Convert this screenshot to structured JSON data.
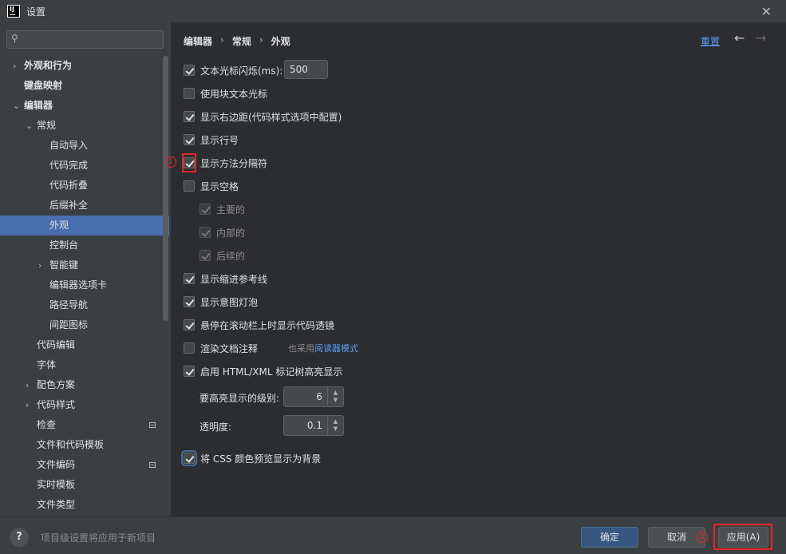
{
  "window": {
    "title": "设置",
    "logo_text": "IJ"
  },
  "search": {
    "placeholder": ""
  },
  "sidebar": {
    "items": [
      {
        "label": "外观和行为",
        "arrow": "›",
        "bold": true
      },
      {
        "label": "键盘映射",
        "bold": true
      },
      {
        "label": "编辑器",
        "arrow": "⌄",
        "bold": true
      },
      {
        "label": "常规",
        "arrow": "⌄"
      },
      {
        "label": "自动导入"
      },
      {
        "label": "代码完成"
      },
      {
        "label": "代码折叠"
      },
      {
        "label": "后缀补全"
      },
      {
        "label": "外观"
      },
      {
        "label": "控制台"
      },
      {
        "label": "智能键",
        "arrow": "›"
      },
      {
        "label": "编辑器选项卡"
      },
      {
        "label": "路径导航"
      },
      {
        "label": "间距图标"
      },
      {
        "label": "代码编辑"
      },
      {
        "label": "字体"
      },
      {
        "label": "配色方案",
        "arrow": "›"
      },
      {
        "label": "代码样式",
        "arrow": "›"
      },
      {
        "label": "检查"
      },
      {
        "label": "文件和代码模板"
      },
      {
        "label": "文件编码"
      },
      {
        "label": "实时模板"
      },
      {
        "label": "文件类型"
      }
    ],
    "selected": "外观"
  },
  "breadcrumb": {
    "items": [
      "编辑器",
      "常规",
      "外观"
    ],
    "separator": "›"
  },
  "header": {
    "reset_label": "重置",
    "back_icon": "←",
    "forward_icon": "→"
  },
  "options": {
    "caret_blink": {
      "label": "文本光标闪烁(ms):",
      "checked": true,
      "value": "500"
    },
    "block_caret": {
      "label": "使用块文本光标",
      "checked": false
    },
    "right_margin": {
      "label": "显示右边距(代码样式选项中配置)",
      "checked": true
    },
    "line_numbers": {
      "label": "显示行号",
      "checked": true
    },
    "method_separators": {
      "label": "显示方法分隔符",
      "checked": true
    },
    "whitespaces": {
      "label": "显示空格",
      "checked": false
    },
    "leading": {
      "label": "主要的",
      "checked": true
    },
    "inner": {
      "label": "内部的",
      "checked": true
    },
    "trailing": {
      "label": "后续的",
      "checked": true
    },
    "indent_guides": {
      "label": "显示缩进参考线",
      "checked": true
    },
    "intention_bulb": {
      "label": "显示意图灯泡",
      "checked": true
    },
    "scrollbar_lens": {
      "label": "悬停在滚动栏上时显示代码透镜",
      "checked": true
    },
    "render_docs": {
      "label": "渲染文档注释",
      "checked": false,
      "hint_prefix": "也采用",
      "hint_link": "阅读器模式"
    },
    "tag_tree": {
      "label": "启用 HTML/XML 标记树高亮显示",
      "checked": true
    },
    "levels": {
      "label": "要高亮显示的级别:",
      "value": "6"
    },
    "opacity": {
      "label": "透明度:",
      "value": "0.1"
    },
    "css_colors": {
      "label": "将 CSS 颜色预览显示为背景",
      "checked": true
    }
  },
  "annotations": {
    "marker1": "1",
    "marker2": "2"
  },
  "footer": {
    "help_label": "?",
    "note": "项目级设置将应用于新项目",
    "ok_label": "确定",
    "cancel_label": "取消",
    "apply_label": "应用(A)"
  },
  "colors": {
    "accent": "#4b6eaf",
    "link": "#589df6",
    "annotation_red": "#e8242c",
    "primary_button": "#365880"
  }
}
